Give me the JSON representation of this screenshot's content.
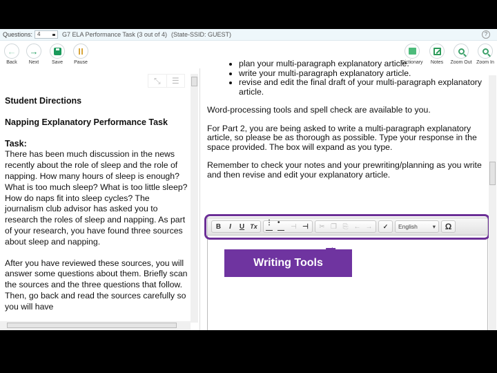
{
  "header": {
    "questions_label": "Questions:",
    "question_number": "4",
    "task_title": "G7 ELA Performance Task (3 out of 4)",
    "student_info": "(State-SSID: GUEST)",
    "help_icon": "?"
  },
  "toolbar": {
    "left": [
      {
        "label": "Back",
        "icon": "back-arrow-icon",
        "color": "#a8d8c0",
        "enabled": false
      },
      {
        "label": "Next",
        "icon": "next-arrow-icon",
        "color": "#1a9a5b",
        "enabled": true
      },
      {
        "label": "Save",
        "icon": "save-icon",
        "color": "#1a9a5b",
        "enabled": true
      },
      {
        "label": "Pause",
        "icon": "pause-icon",
        "color": "#d8a53a",
        "enabled": true
      }
    ],
    "right": [
      {
        "label": "Dictionary",
        "icon": "dictionary-icon"
      },
      {
        "label": "Notes",
        "icon": "notes-icon"
      },
      {
        "label": "Zoom Out",
        "icon": "zoom-out-icon"
      },
      {
        "label": "Zoom In",
        "icon": "zoom-in-icon"
      }
    ]
  },
  "passage": {
    "heading1": "Student Directions",
    "heading2": "Napping Explanatory Performance Task",
    "task_heading": "Task:",
    "paragraph1": "There has been much discussion in the news recently about the role of sleep and the role of napping. How many hours of sleep is enough? What is too much sleep? What is too little sleep? How do naps fit into sleep cycles? The journalism club advisor has asked you to research the roles of sleep and napping. As part of your research, you have found three sources about sleep and napping.",
    "paragraph2": "After you have reviewed these sources, you will answer some questions about them. Briefly scan the sources and the three questions that follow. Then, go back and read the sources carefully so you will have"
  },
  "instructions": {
    "bullets": [
      "plan your multi-paragraph explanatory article.",
      "write your multi-paragraph explanatory article.",
      "revise and edit the final draft of your multi-paragraph explanatory article."
    ],
    "p1": "Word-processing tools and spell check are available to you.",
    "p2": "For Part 2, you are being asked to write a multi-paragraph explanatory article, so please be as thorough as possible. Type your response in the space provided. The box will expand as you type.",
    "p3": "Remember to check your notes and your prewriting/planning as you write and then revise and edit your explanatory article."
  },
  "editor": {
    "format_buttons": [
      "B",
      "I",
      "U",
      "Tx"
    ],
    "list_buttons": [
      "numbered-list",
      "bulleted-list",
      "outdent",
      "indent"
    ],
    "edit_buttons": [
      "cut",
      "copy",
      "paste",
      "undo",
      "redo"
    ],
    "spellcheck": "spellcheck",
    "language": "English",
    "special_char": "Ω",
    "response_text": ""
  },
  "annotation": {
    "label": "Writing Tools",
    "color": "#6f34a0"
  }
}
